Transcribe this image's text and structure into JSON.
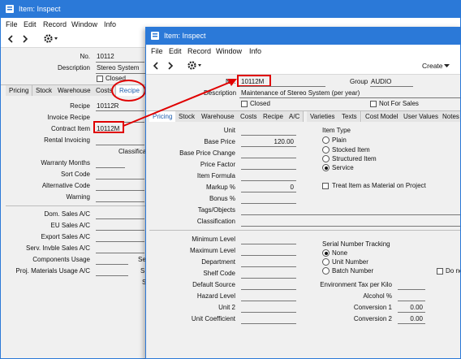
{
  "back_window": {
    "title": "Item: Inspect",
    "menu": [
      "File",
      "Edit",
      "Record",
      "Window",
      "Info"
    ],
    "fields": {
      "no_label": "No.",
      "no_value": "10112",
      "description_label": "Description",
      "description_value": "Stereo System",
      "closed_label": "Closed"
    },
    "tabs": [
      "Pricing",
      "Stock",
      "Warehouse",
      "Costs",
      "Recipe"
    ],
    "recipe": {
      "recipe_label": "Recipe",
      "recipe_value": "10112R",
      "invoice_recipe_label": "Invoice Recipe",
      "contract_item_label": "Contract Item",
      "contract_item_value": "10112M",
      "rental_invoicing_label": "Rental Invoicing",
      "classification_label": "Classificati",
      "warranty_months_label": "Warranty Months",
      "sort_code_label": "Sort Code",
      "alternative_code_label": "Alternative Code",
      "warning_label": "Warning",
      "dom_sales_label": "Dom. Sales A/C",
      "eu_sales_label": "EU Sales A/C",
      "export_sales_label": "Export Sales A/C",
      "serv_invble_label": "Serv. Invble Sales A/C",
      "components_usage_label": "Components Usage",
      "proj_materials_label": "Proj. Materials Usage A/C",
      "partial_s1": "Se",
      "partial_s2": "S",
      "partial_s3": "S"
    }
  },
  "front_window": {
    "title": "Item: Inspect",
    "menu": [
      "File",
      "Edit",
      "Record",
      "Window",
      "Info"
    ],
    "create_label": "Create",
    "header": {
      "no_label": "No.",
      "no_value": "10112M",
      "group_label": "Group",
      "group_value": "AUDIO",
      "description_label": "Description",
      "description_value": "Maintenance of Stereo System (per year)",
      "closed_label": "Closed",
      "not_for_sales_label": "Not For Sales"
    },
    "tabs": [
      "Pricing",
      "Stock",
      "Warehouse",
      "Costs",
      "Recipe",
      "A/C",
      "Varieties",
      "Texts",
      "Cost Model",
      "User Values",
      "Notes"
    ],
    "pricing": {
      "unit_label": "Unit",
      "base_price_label": "Base Price",
      "base_price_value": "120.00",
      "base_price_change_label": "Base Price Change",
      "price_factor_label": "Price Factor",
      "item_formula_label": "Item Formula",
      "markup_label": "Markup %",
      "markup_value": "0",
      "bonus_label": "Bonus %",
      "tags_label": "Tags/Objects",
      "classification_label": "Classification",
      "item_type_label": "Item Type",
      "item_type_options": [
        "Plain",
        "Stocked Item",
        "Structured Item",
        "Service"
      ],
      "item_type_selected": "Service",
      "treat_item_label": "Treat Item as Material on Project",
      "minimum_level_label": "Minimum Level",
      "maximum_level_label": "Maximum Level",
      "department_label": "Department",
      "shelf_code_label": "Shelf Code",
      "default_source_label": "Default Source",
      "hazard_level_label": "Hazard Level",
      "unit2_label": "Unit 2",
      "unit_coefficient_label": "Unit Coefficient",
      "serial_tracking_label": "Serial Number Tracking",
      "serial_options": [
        "None",
        "Unit Number",
        "Batch Number"
      ],
      "serial_selected": "None",
      "do_not_label": "Do no",
      "env_tax_label": "Environment Tax per Kilo",
      "alcohol_label": "Alcohol %",
      "conversion1_label": "Conversion 1",
      "conversion1_value": "0.00",
      "conversion2_label": "Conversion 2",
      "conversion2_value": "0.00"
    }
  },
  "colors": {
    "titlebar": "#2b79d8",
    "highlight": "#e00000",
    "window_bg": "#f0f0f0",
    "active_tab_text": "#1f5fae"
  }
}
